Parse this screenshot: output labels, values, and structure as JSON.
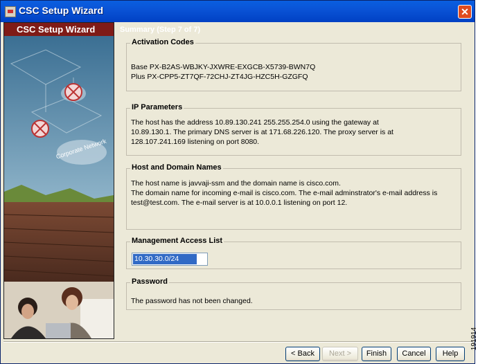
{
  "window": {
    "title": "CSC Setup Wizard",
    "close_glyph": "✕"
  },
  "sidebar": {
    "header": "CSC Setup Wizard",
    "diagram_label": "Corporate Network"
  },
  "banner": {
    "text": "Summary (Step 7 of 7)"
  },
  "activation_codes": {
    "title": "Activation Codes",
    "lines": [
      "Base PX-B2AS-WBJKY-JXWRE-EXGCB-X5739-BWN7Q",
      "Plus PX-CPP5-ZT7QF-72CHJ-ZT4JG-HZC5H-GZGFQ"
    ]
  },
  "ip_parameters": {
    "title": "IP Parameters",
    "lines": [
      "The host has the address 10.89.130.241 255.255.254.0 using the gateway at",
      "10.89.130.1. The primary DNS server is at 171.68.226.120. The proxy server is at",
      "128.107.241.169 listening on port 8080."
    ]
  },
  "host_domain": {
    "title": "Host and Domain Names",
    "lines": [
      "The host name is javvaji-ssm and the domain name is cisco.com.",
      "The domain name for incoming e-mail is cisco.com. The e-mail adminstrator's e-mail address is",
      "test@test.com. The e-mail server is at 10.0.0.1 listening on port 12."
    ]
  },
  "management": {
    "title": "Management Access List",
    "value": "10.30.30.0/24"
  },
  "password": {
    "title": "Password",
    "text": "The password has not been changed."
  },
  "buttons": {
    "back": "< Back",
    "next": "Next >",
    "finish": "Finish",
    "cancel": "Cancel",
    "help": "Help"
  },
  "figure_number": "191914",
  "colors": {
    "title_bar": "#0a53d6",
    "sidebar_header": "#7f1b17",
    "selection": "#316ac5",
    "dialog_bg": "#ece9d8"
  }
}
